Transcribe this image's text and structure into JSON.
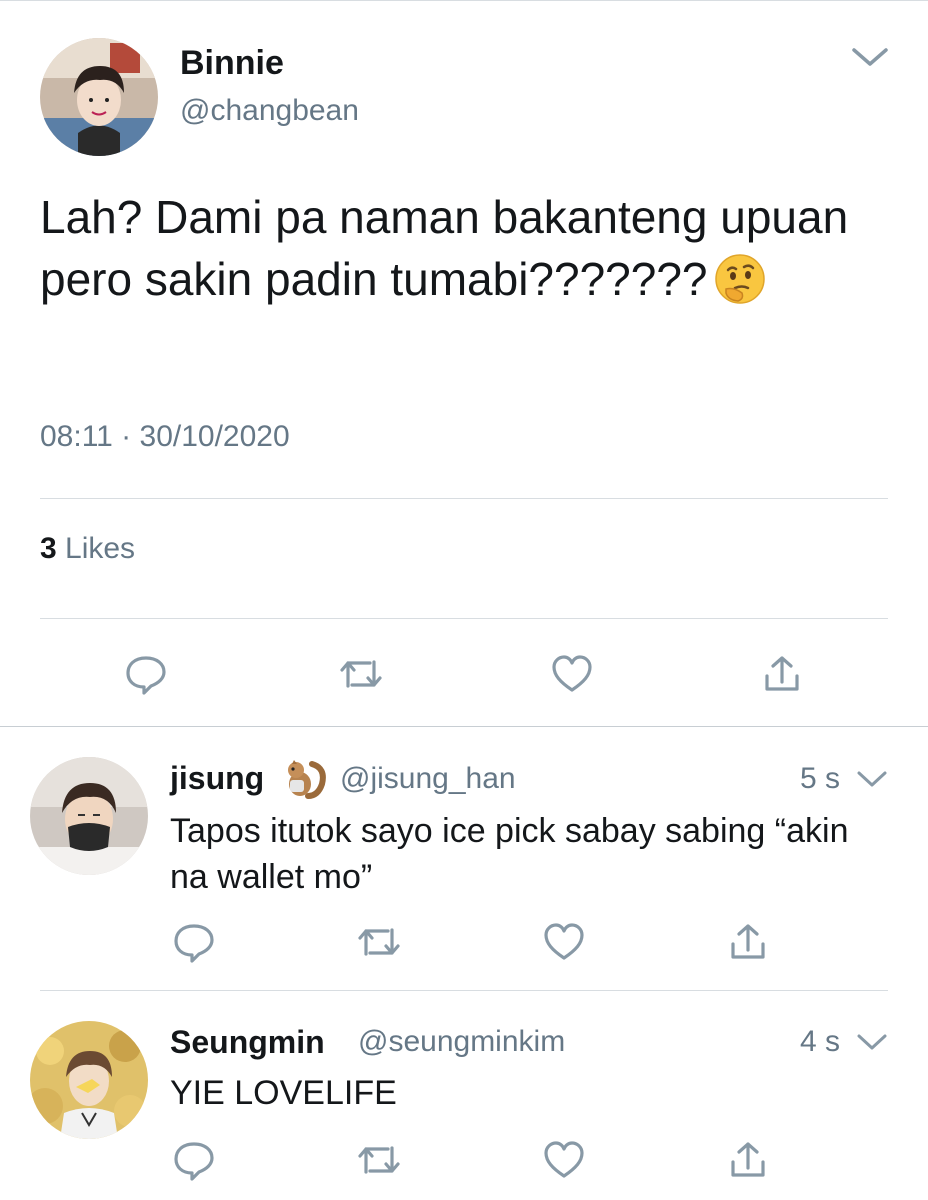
{
  "main_tweet": {
    "name": "Binnie",
    "handle": "@changbean",
    "text": "Lah? Dami pa naman bakanteng upuan pero sakin padin tumabi???????",
    "emoji": "thinking-face",
    "timestamp": "08:11 · 30/10/2020",
    "likes_count": "3",
    "likes_label": " Likes"
  },
  "replies": [
    {
      "name": "jisung",
      "name_emoji": "chipmunk",
      "handle": "@jisung_han",
      "time": "5 s",
      "text": "Tapos itutok sayo ice pick sabay sabing “akin na wallet mo”"
    },
    {
      "name": "Seungmin",
      "handle": "@seungminkim",
      "time": "4 s",
      "text": "YIE LOVELIFE"
    }
  ],
  "icons": {
    "reply": "reply-icon",
    "retweet": "retweet-icon",
    "like": "heart-icon",
    "share": "share-icon",
    "more": "chevron-down-icon"
  },
  "colors": {
    "text": "#14171a",
    "secondary": "#657786",
    "divider": "#d8dde1"
  }
}
